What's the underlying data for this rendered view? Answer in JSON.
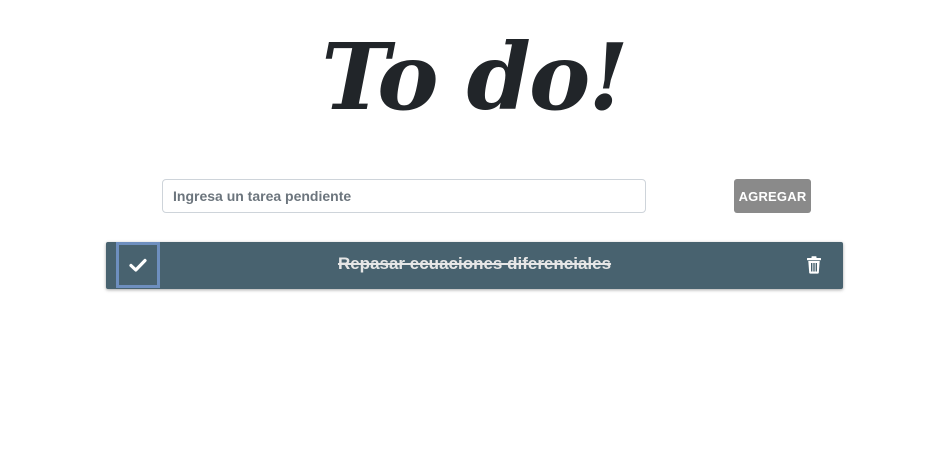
{
  "header": {
    "title": "To do!"
  },
  "form": {
    "input_placeholder": "Ingresa un tarea pendiente",
    "input_value": "",
    "add_label": "AGREGAR"
  },
  "tasks": [
    {
      "text": "Repasar ecuaciones diferenciales",
      "completed": true,
      "check_icon": "check-icon",
      "delete_icon": "trash-icon"
    }
  ],
  "colors": {
    "title": "#212529",
    "task_background": "#48626f",
    "check_border": "#6e8fbf",
    "add_button": "#8a8a8a"
  }
}
